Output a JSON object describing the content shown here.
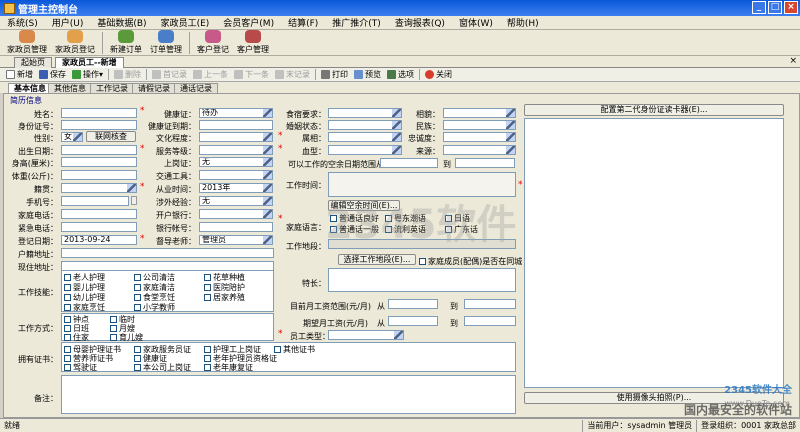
{
  "window": {
    "title": "管理主控制台"
  },
  "menubar": {
    "items": [
      "系统(S)",
      "用户(U)",
      "基础数据(B)",
      "家政员工(E)",
      "会员客户(M)",
      "结算(F)",
      "推广推介(T)",
      "查询报表(Q)",
      "窗体(W)",
      "帮助(H)"
    ]
  },
  "quickbar": {
    "items": [
      "家政员管理",
      "家政员登记",
      "新建订单",
      "订单管理",
      "客户登记",
      "客户管理"
    ]
  },
  "doctabs": {
    "home": "起始页",
    "current": "家政员工--新增",
    "close": "×"
  },
  "toolbar": {
    "new": "新增",
    "save": "保存",
    "action": "操作",
    "delete": "删除",
    "first": "首记录",
    "prev": "上一条",
    "next": "下一条",
    "last": "末记录",
    "print": "打印",
    "preview": "预览",
    "options": "选项",
    "close": "关闭"
  },
  "subtabs": [
    "基本信息",
    "其他信息",
    "工作记录",
    "请假记录",
    "通话记录"
  ],
  "section": {
    "title": "简历信息"
  },
  "form": {
    "name_label": "姓名：",
    "idcard_label": "身份证号：",
    "gender_label": "性别：",
    "gender_value": "女",
    "verify_button": "联网核查",
    "birth_label": "出生日期：",
    "height_label": "身高(厘米)：",
    "weight_label": "体重(公斤)：",
    "native_label": "籍贯：",
    "phone_label": "手机号：",
    "homephone_label": "家庭电话：",
    "emergency_label": "紧急电话：",
    "regdate_label": "登记日期：",
    "regdate_value": "2013-09-24",
    "hukou_label": "户籍地址：",
    "current_addr_label": "现住地址：",
    "health_label": "健康证：",
    "health_value": "待办",
    "health_expire_label": "健康证到期：",
    "education_label": "文化程度：",
    "service_level_label": "服务等级：",
    "onpost_label": "上岗证：",
    "onpost_value": "无",
    "transport_label": "交通工具：",
    "work_since_label": "从业时间：",
    "work_since_value": "2013年",
    "foreign_label": "涉外经验：",
    "foreign_value": "无",
    "bank_label": "开户银行：",
    "bank_account_label": "银行帐号：",
    "agent_label": "督导老师：",
    "agent_value": "管理员",
    "diet_label": "食宿要求：",
    "marital_label": "婚姻状态：",
    "zodiac_label": "属相：",
    "blood_label": "血型：",
    "pregnancy_label": "相貌：",
    "ethnic_label": "民族：",
    "loyalty_label": "忠诚度：",
    "source_label": "来源：",
    "available_label": "可以工作的空余日期范围从",
    "to_label": "到",
    "worktime_label": "工作时间：",
    "edit_free_button": "编辑空余时间(E)...",
    "family_lang_label": "家庭语言：",
    "lang": [
      "普通话良好",
      "粤东潮语",
      "日语",
      "普通话一般",
      "流利英语",
      "广东话"
    ],
    "work_area_label": "工作地段：",
    "select_area_button": "选择工作地段(E)...",
    "same_city_label": "家庭成员(配偶)是否在同城",
    "specialty_label": "特长：",
    "salary_range_label": "目前月工资范围(元/月)",
    "expected_salary_label": "期望月工资(元/月)",
    "from_label": "从",
    "to2_label": "到",
    "staff_type_label": "员工类型：",
    "skills_label": "工作技能：",
    "skills": [
      "老人护理",
      "公司清洁",
      "花草种植",
      "婴儿护理",
      "家庭清洁",
      "医院陪护",
      "幼儿护理",
      "食堂烹饪",
      "居家养殖",
      "家庭烹饪",
      "小学教师"
    ],
    "workmode_label": "工作方式：",
    "workmode": [
      "钟点",
      "临时",
      "日班",
      "月嫂",
      "住家",
      "育儿嫂"
    ],
    "certs_label": "拥有证书：",
    "certs": [
      "母婴护理证书",
      "家政服务员证",
      "护理工上岗证",
      "其他证书",
      "营养师证书",
      "健康证",
      "老年护理员资格证",
      "驾驶证",
      "本公司上岗证",
      "老年康复证"
    ],
    "remark_label": "备注：",
    "read_card_button": "配置第二代身份证读卡器(E)...",
    "photo_button": "使用摄像头拍照(P)..."
  },
  "status": {
    "ready": "就绪",
    "user": "当前用户：sysadmin 管理员",
    "org": "登录组织：0001 家政总部"
  },
  "watermark": {
    "site": "2345软件大全",
    "domain": "www.DuoTe.com",
    "safe": "国内最安全的软件站",
    "big": "2345软件"
  }
}
